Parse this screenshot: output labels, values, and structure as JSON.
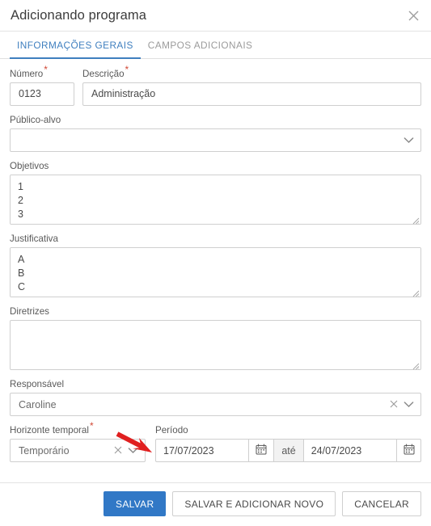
{
  "dialog": {
    "title": "Adicionando programa",
    "close_icon": "close-icon"
  },
  "tabs": [
    {
      "label": "INFORMAÇÕES GERAIS",
      "active": true
    },
    {
      "label": "CAMPOS ADICIONAIS",
      "active": false
    }
  ],
  "fields": {
    "numero": {
      "label": "Número",
      "required": true,
      "value": "0123",
      "placeholder": ""
    },
    "descricao": {
      "label": "Descrição",
      "required": true,
      "value": "Administração",
      "placeholder": ""
    },
    "publico_alvo": {
      "label": "Público-alvo",
      "required": false,
      "value": "",
      "placeholder": "",
      "chevron_icon": "chevron-down-icon"
    },
    "objetivos": {
      "label": "Objetivos",
      "required": false,
      "value": "1\n2\n3",
      "placeholder": ""
    },
    "justificativa": {
      "label": "Justificativa",
      "required": false,
      "value": "A\nB\nC",
      "placeholder": ""
    },
    "diretrizes": {
      "label": "Diretrizes",
      "required": false,
      "value": "",
      "placeholder": ""
    },
    "responsavel": {
      "label": "Responsável",
      "required": false,
      "value": "Caroline",
      "placeholder": "",
      "clear_icon": "clear-x-icon",
      "chevron_icon": "chevron-down-icon"
    },
    "horizonte_temporal": {
      "label": "Horizonte temporal",
      "required": true,
      "value": "Temporário",
      "placeholder": "",
      "clear_icon": "clear-x-icon",
      "chevron_icon": "chevron-down-icon"
    },
    "periodo": {
      "label": "Período",
      "required": false,
      "start_value": "17/07/2023",
      "separator_label": "até",
      "end_value": "24/07/2023",
      "start_calendar_icon": "calendar-icon",
      "end_calendar_icon": "calendar-icon"
    }
  },
  "footer": {
    "save_label": "SALVAR",
    "save_and_add_label": "SALVAR E ADICIONAR NOVO",
    "cancel_label": "CANCELAR"
  },
  "annotation": {
    "arrow_icon": "red-arrow-icon",
    "arrow_color": "#e02020"
  },
  "colors": {
    "primary": "#3178c6",
    "tab_active": "#3f7fbf",
    "required_asterisk": "#d14836",
    "border": "#cfcfcf",
    "text": "#4a4a4a",
    "label": "#595959"
  }
}
